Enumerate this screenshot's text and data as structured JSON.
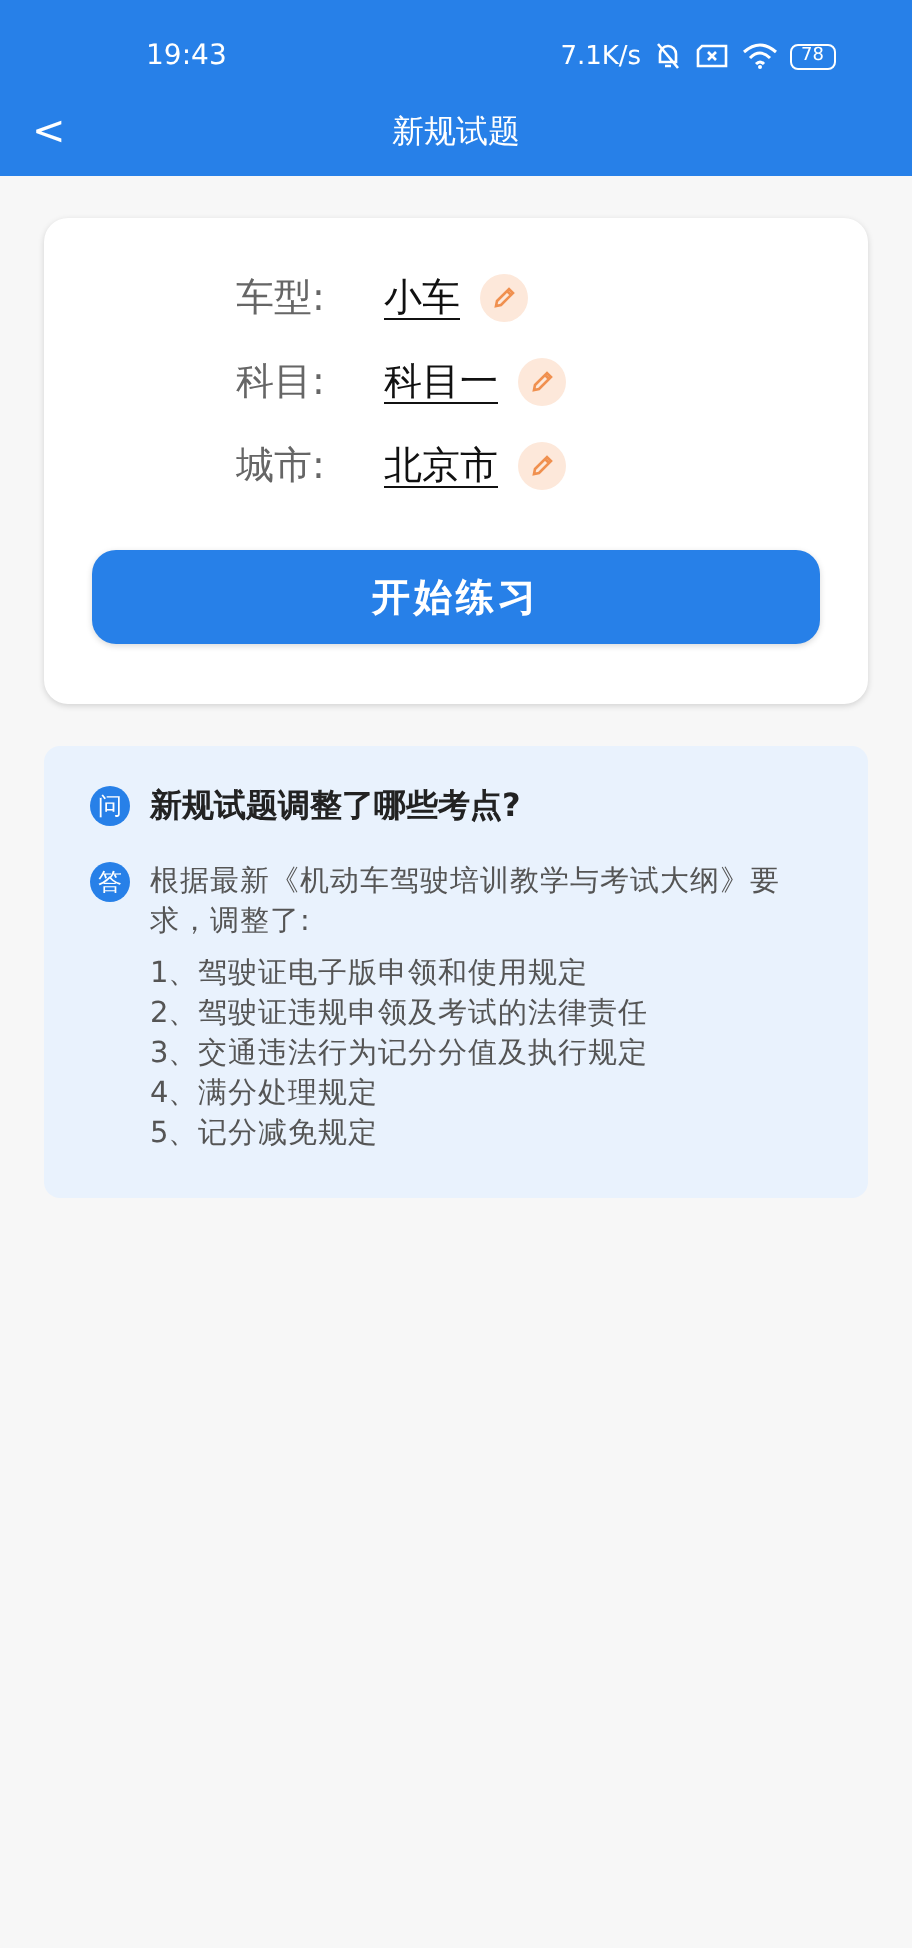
{
  "status_bar": {
    "time": "19:43",
    "speed": "7.1K/s",
    "battery": "78"
  },
  "header": {
    "back": "<",
    "title": "新规试题"
  },
  "settings": [
    {
      "label": "车型:",
      "value": "小车"
    },
    {
      "label": "科目:",
      "value": "科目一"
    },
    {
      "label": "城市:",
      "value": "北京市"
    }
  ],
  "start_button": "开始练习",
  "qa": {
    "q_badge": "问",
    "question": "新规试题调整了哪些考点?",
    "a_badge": "答",
    "answer": "根据最新《机动车驾驶培训教学与考试大纲》要求，调整了:",
    "items": [
      "1、驾驶证电子版申领和使用规定",
      "2、驾驶证违规申领及考试的法律责任",
      "3、交通违法行为记分分值及执行规定",
      "4、满分处理规定",
      "5、记分减免规定"
    ]
  }
}
